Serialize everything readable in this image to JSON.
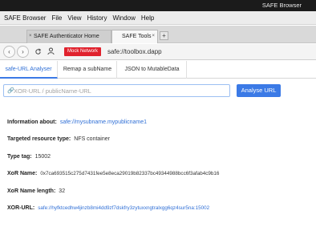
{
  "os_bar": {
    "title": "SAFE Browser"
  },
  "menu": [
    "SAFE Browser",
    "File",
    "View",
    "History",
    "Window",
    "Help"
  ],
  "tabs": [
    {
      "label": "SAFE Authenticator Home",
      "close": "×"
    },
    {
      "label": "SAFE Tools",
      "close": "×"
    }
  ],
  "new_tab_label": "+",
  "nav": {
    "back_icon": "‹",
    "forward_icon": "›",
    "reload_icon": "C",
    "account_icon": "person-icon",
    "mock_label": "Mock Network",
    "address": "safe://toolbox.dapp"
  },
  "page_tabs": [
    "safe-URL Analyser",
    "Remap a subName",
    "JSON to MutableData"
  ],
  "search": {
    "placeholder": "XOR-URL / publicName-URL",
    "value": "",
    "button": "Analyse URL"
  },
  "results": [
    {
      "label": "Information about:",
      "value": "safe://mysubname.mypublicname1",
      "link": true
    },
    {
      "label": "Targeted resource type:",
      "value": "NFS container",
      "link": false
    },
    {
      "label": "Type tag:",
      "value": "15002",
      "link": false
    },
    {
      "label": "XoR Name:",
      "value": "0x7ca693515c275d7431fee5e8eca29019b82337bc49344988bcc6f3afab4c9b16",
      "link": false
    },
    {
      "label": "XoR Name length:",
      "value": "32",
      "link": false
    },
    {
      "label": "XOR-URL:",
      "value": "safe://hyfktcedhw4jinzb8mi4dd9zf7dskfry3zytuxxngtralxgg6qz4sur5na:15002",
      "link": true
    }
  ],
  "colors": {
    "accent": "#3b7ae6",
    "mock_badge": "#e0222d"
  }
}
